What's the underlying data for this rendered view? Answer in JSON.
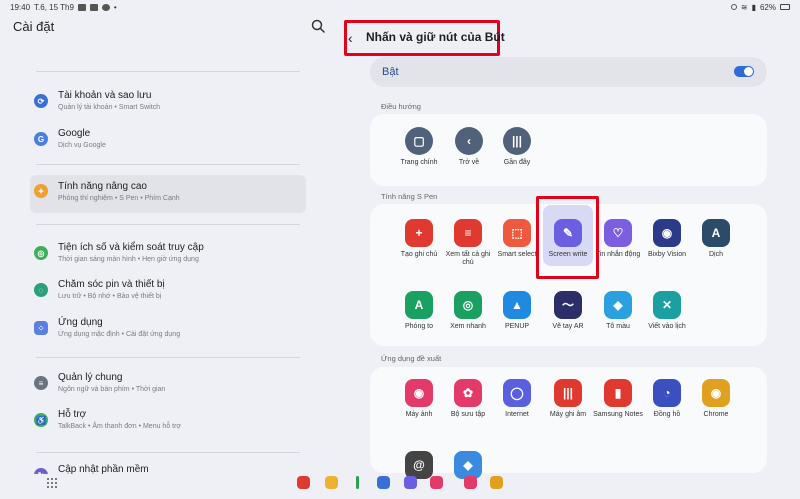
{
  "status_bar": {
    "time": "19:40",
    "date": "T.6, 15 Th9",
    "battery": "62%"
  },
  "left_pane": {
    "title": "Cài đặt",
    "items": [
      {
        "title": "Tài khoản và sao lưu",
        "subtitle": "Quản lý tài khoản  •  Smart Switch",
        "icon": "sync-icon",
        "color": "#3a6fd8"
      },
      {
        "title": "Google",
        "subtitle": "Dịch vụ Google",
        "icon": "google-icon",
        "color": "#4a7fe0"
      },
      {
        "title": "Tính năng nâng cao",
        "subtitle": "Phòng thí nghiệm  •  S Pen  •  Phím Cạnh",
        "icon": "gear-star-icon",
        "color": "#f0a030"
      },
      {
        "title": "Tiện ích số và kiểm soát truy cập",
        "subtitle": "Thời gian sáng màn hình  •  Hẹn giờ ứng dụng",
        "icon": "digital-wellbeing-icon",
        "color": "#3fae5a"
      },
      {
        "title": "Chăm sóc pin và thiết bị",
        "subtitle": "Lưu trữ  •  Bộ nhớ  •  Bảo vệ thiết bị",
        "icon": "device-care-icon",
        "color": "#2aa07a"
      },
      {
        "title": "Ứng dụng",
        "subtitle": "Ứng dụng mặc định  •  Cài đặt ứng dụng",
        "icon": "apps-icon",
        "color": "#5a7fe0"
      },
      {
        "title": "Quản lý chung",
        "subtitle": "Ngôn ngữ và bàn phím  •  Thời gian",
        "icon": "general-management-icon",
        "color": "#6a7380"
      },
      {
        "title": "Hỗ trợ",
        "subtitle": "TalkBack  •  Âm thanh đơn  •  Menu hỗ trợ",
        "icon": "accessibility-icon",
        "color": "#3fae5a"
      },
      {
        "title": "Cập nhật phần mềm",
        "subtitle": "",
        "icon": "software-update-icon",
        "color": "#6a5fd0"
      }
    ]
  },
  "right_pane": {
    "title": "Nhấn và giữ nút của Bút",
    "toggle": {
      "label": "Bật",
      "on": true
    },
    "sections": [
      {
        "label": "Điều hướng",
        "apps": [
          {
            "label": "Trang chính",
            "icon": "home-icon",
            "glyph": "▢",
            "color": "#50617a"
          },
          {
            "label": "Trở về",
            "icon": "back-icon",
            "glyph": "‹",
            "color": "#50617a"
          },
          {
            "label": "Gần đây",
            "icon": "recents-icon",
            "glyph": "|||",
            "color": "#50617a"
          }
        ]
      },
      {
        "label": "Tính năng S Pen",
        "apps": [
          {
            "label": "Tạo ghi chú",
            "icon": "create-note-icon",
            "glyph": "+",
            "color": "#e0392f"
          },
          {
            "label": "Xem tất cả ghi chú",
            "icon": "view-notes-icon",
            "glyph": "≡",
            "color": "#e0392f"
          },
          {
            "label": "Smart select",
            "icon": "smart-select-icon",
            "glyph": "⬚",
            "color": "#ef5a3f"
          },
          {
            "label": "Screen write",
            "icon": "screen-write-icon",
            "glyph": "✎",
            "color": "#6a5fe0"
          },
          {
            "label": "Tin nhắn động",
            "icon": "live-message-icon",
            "glyph": "♡",
            "color": "#7a5fe0"
          },
          {
            "label": "Bixby Vision",
            "icon": "bixby-vision-icon",
            "glyph": "◉",
            "color": "#2c3a8a"
          },
          {
            "label": "Dịch",
            "icon": "translate-icon",
            "glyph": "A",
            "color": "#2c4a6a"
          },
          {
            "label": "Phóng to",
            "icon": "magnify-icon",
            "glyph": "A",
            "color": "#1aa060"
          },
          {
            "label": "Xem nhanh",
            "icon": "glance-icon",
            "glyph": "◎",
            "color": "#1aa060"
          },
          {
            "label": "PENUP",
            "icon": "penup-icon",
            "glyph": "▲",
            "color": "#1f8ae0"
          },
          {
            "label": "Vẽ tay AR",
            "icon": "ar-doodle-icon",
            "glyph": "〜",
            "color": "#2c2e6a"
          },
          {
            "label": "Tô màu",
            "icon": "coloring-icon",
            "glyph": "◆",
            "color": "#2aa0e0"
          },
          {
            "label": "Viết vào lịch",
            "icon": "write-calendar-icon",
            "glyph": "✕",
            "color": "#1aa0a0"
          }
        ]
      },
      {
        "label": "Ứng dụng đề xuất",
        "apps": [
          {
            "label": "Máy ảnh",
            "icon": "camera-icon",
            "glyph": "◉",
            "color": "#e33a6a"
          },
          {
            "label": "Bộ sưu tập",
            "icon": "gallery-icon",
            "glyph": "✿",
            "color": "#e33a6a"
          },
          {
            "label": "Internet",
            "icon": "internet-icon",
            "glyph": "◯",
            "color": "#5a5fe0"
          },
          {
            "label": "Máy ghi âm",
            "icon": "voice-recorder-icon",
            "glyph": "|||",
            "color": "#e0392f"
          },
          {
            "label": "Samsung Notes",
            "icon": "samsung-notes-icon",
            "glyph": "▮",
            "color": "#e0392f"
          },
          {
            "label": "Đồng hồ",
            "icon": "clock-icon",
            "glyph": "◔",
            "color": "#3a4fc0"
          },
          {
            "label": "Chrome",
            "icon": "chrome-icon",
            "glyph": "◉",
            "color": "#e0a020"
          },
          {
            "label": "",
            "icon": "threads-icon",
            "glyph": "@",
            "color": "#444444"
          },
          {
            "label": "",
            "icon": "copilot-icon",
            "glyph": "◆",
            "color": "#3a8ae0"
          }
        ]
      }
    ]
  },
  "taskbar": {
    "icons": [
      {
        "icon": "samsung-notes-taskbar-icon",
        "color": "#e0392f"
      },
      {
        "icon": "my-files-taskbar-icon",
        "color": "#f0b030"
      },
      {
        "icon": "phone-taskbar-icon",
        "color": "#2aa050"
      },
      {
        "icon": "messages-taskbar-icon",
        "color": "#3a6fd8"
      },
      {
        "icon": "internet-taskbar-icon",
        "color": "#6a5fe0"
      },
      {
        "icon": "camera-taskbar-icon",
        "color": "#e33a6a"
      },
      {
        "icon": "gallery-taskbar-icon",
        "color": "#e33a6a"
      },
      {
        "icon": "chrome-taskbar-icon",
        "color": "#e0a020"
      }
    ]
  }
}
